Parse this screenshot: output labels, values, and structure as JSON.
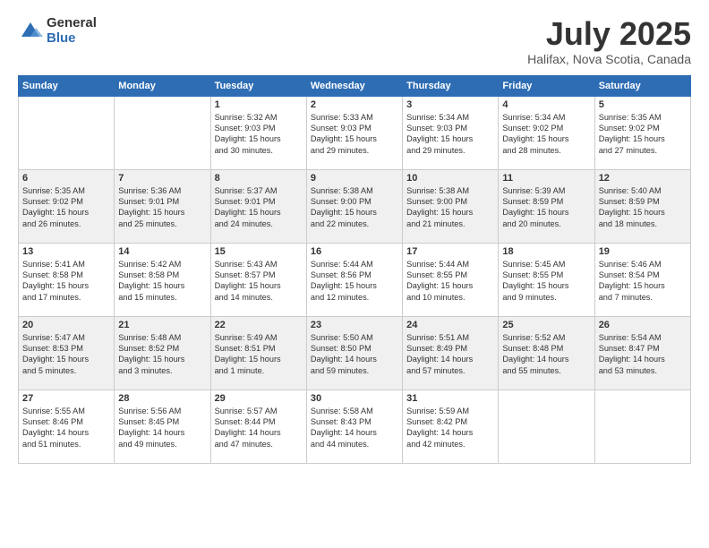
{
  "header": {
    "logo_general": "General",
    "logo_blue": "Blue",
    "month": "July 2025",
    "location": "Halifax, Nova Scotia, Canada"
  },
  "weekdays": [
    "Sunday",
    "Monday",
    "Tuesday",
    "Wednesday",
    "Thursday",
    "Friday",
    "Saturday"
  ],
  "rows": [
    [
      {
        "day": "",
        "lines": []
      },
      {
        "day": "",
        "lines": []
      },
      {
        "day": "1",
        "lines": [
          "Sunrise: 5:32 AM",
          "Sunset: 9:03 PM",
          "Daylight: 15 hours",
          "and 30 minutes."
        ]
      },
      {
        "day": "2",
        "lines": [
          "Sunrise: 5:33 AM",
          "Sunset: 9:03 PM",
          "Daylight: 15 hours",
          "and 29 minutes."
        ]
      },
      {
        "day": "3",
        "lines": [
          "Sunrise: 5:34 AM",
          "Sunset: 9:03 PM",
          "Daylight: 15 hours",
          "and 29 minutes."
        ]
      },
      {
        "day": "4",
        "lines": [
          "Sunrise: 5:34 AM",
          "Sunset: 9:02 PM",
          "Daylight: 15 hours",
          "and 28 minutes."
        ]
      },
      {
        "day": "5",
        "lines": [
          "Sunrise: 5:35 AM",
          "Sunset: 9:02 PM",
          "Daylight: 15 hours",
          "and 27 minutes."
        ]
      }
    ],
    [
      {
        "day": "6",
        "lines": [
          "Sunrise: 5:35 AM",
          "Sunset: 9:02 PM",
          "Daylight: 15 hours",
          "and 26 minutes."
        ]
      },
      {
        "day": "7",
        "lines": [
          "Sunrise: 5:36 AM",
          "Sunset: 9:01 PM",
          "Daylight: 15 hours",
          "and 25 minutes."
        ]
      },
      {
        "day": "8",
        "lines": [
          "Sunrise: 5:37 AM",
          "Sunset: 9:01 PM",
          "Daylight: 15 hours",
          "and 24 minutes."
        ]
      },
      {
        "day": "9",
        "lines": [
          "Sunrise: 5:38 AM",
          "Sunset: 9:00 PM",
          "Daylight: 15 hours",
          "and 22 minutes."
        ]
      },
      {
        "day": "10",
        "lines": [
          "Sunrise: 5:38 AM",
          "Sunset: 9:00 PM",
          "Daylight: 15 hours",
          "and 21 minutes."
        ]
      },
      {
        "day": "11",
        "lines": [
          "Sunrise: 5:39 AM",
          "Sunset: 8:59 PM",
          "Daylight: 15 hours",
          "and 20 minutes."
        ]
      },
      {
        "day": "12",
        "lines": [
          "Sunrise: 5:40 AM",
          "Sunset: 8:59 PM",
          "Daylight: 15 hours",
          "and 18 minutes."
        ]
      }
    ],
    [
      {
        "day": "13",
        "lines": [
          "Sunrise: 5:41 AM",
          "Sunset: 8:58 PM",
          "Daylight: 15 hours",
          "and 17 minutes."
        ]
      },
      {
        "day": "14",
        "lines": [
          "Sunrise: 5:42 AM",
          "Sunset: 8:58 PM",
          "Daylight: 15 hours",
          "and 15 minutes."
        ]
      },
      {
        "day": "15",
        "lines": [
          "Sunrise: 5:43 AM",
          "Sunset: 8:57 PM",
          "Daylight: 15 hours",
          "and 14 minutes."
        ]
      },
      {
        "day": "16",
        "lines": [
          "Sunrise: 5:44 AM",
          "Sunset: 8:56 PM",
          "Daylight: 15 hours",
          "and 12 minutes."
        ]
      },
      {
        "day": "17",
        "lines": [
          "Sunrise: 5:44 AM",
          "Sunset: 8:55 PM",
          "Daylight: 15 hours",
          "and 10 minutes."
        ]
      },
      {
        "day": "18",
        "lines": [
          "Sunrise: 5:45 AM",
          "Sunset: 8:55 PM",
          "Daylight: 15 hours",
          "and 9 minutes."
        ]
      },
      {
        "day": "19",
        "lines": [
          "Sunrise: 5:46 AM",
          "Sunset: 8:54 PM",
          "Daylight: 15 hours",
          "and 7 minutes."
        ]
      }
    ],
    [
      {
        "day": "20",
        "lines": [
          "Sunrise: 5:47 AM",
          "Sunset: 8:53 PM",
          "Daylight: 15 hours",
          "and 5 minutes."
        ]
      },
      {
        "day": "21",
        "lines": [
          "Sunrise: 5:48 AM",
          "Sunset: 8:52 PM",
          "Daylight: 15 hours",
          "and 3 minutes."
        ]
      },
      {
        "day": "22",
        "lines": [
          "Sunrise: 5:49 AM",
          "Sunset: 8:51 PM",
          "Daylight: 15 hours",
          "and 1 minute."
        ]
      },
      {
        "day": "23",
        "lines": [
          "Sunrise: 5:50 AM",
          "Sunset: 8:50 PM",
          "Daylight: 14 hours",
          "and 59 minutes."
        ]
      },
      {
        "day": "24",
        "lines": [
          "Sunrise: 5:51 AM",
          "Sunset: 8:49 PM",
          "Daylight: 14 hours",
          "and 57 minutes."
        ]
      },
      {
        "day": "25",
        "lines": [
          "Sunrise: 5:52 AM",
          "Sunset: 8:48 PM",
          "Daylight: 14 hours",
          "and 55 minutes."
        ]
      },
      {
        "day": "26",
        "lines": [
          "Sunrise: 5:54 AM",
          "Sunset: 8:47 PM",
          "Daylight: 14 hours",
          "and 53 minutes."
        ]
      }
    ],
    [
      {
        "day": "27",
        "lines": [
          "Sunrise: 5:55 AM",
          "Sunset: 8:46 PM",
          "Daylight: 14 hours",
          "and 51 minutes."
        ]
      },
      {
        "day": "28",
        "lines": [
          "Sunrise: 5:56 AM",
          "Sunset: 8:45 PM",
          "Daylight: 14 hours",
          "and 49 minutes."
        ]
      },
      {
        "day": "29",
        "lines": [
          "Sunrise: 5:57 AM",
          "Sunset: 8:44 PM",
          "Daylight: 14 hours",
          "and 47 minutes."
        ]
      },
      {
        "day": "30",
        "lines": [
          "Sunrise: 5:58 AM",
          "Sunset: 8:43 PM",
          "Daylight: 14 hours",
          "and 44 minutes."
        ]
      },
      {
        "day": "31",
        "lines": [
          "Sunrise: 5:59 AM",
          "Sunset: 8:42 PM",
          "Daylight: 14 hours",
          "and 42 minutes."
        ]
      },
      {
        "day": "",
        "lines": []
      },
      {
        "day": "",
        "lines": []
      }
    ]
  ]
}
